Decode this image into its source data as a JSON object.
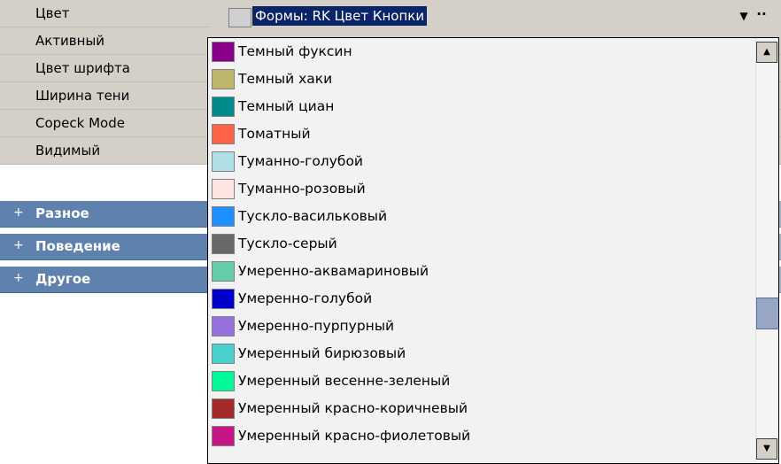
{
  "properties": [
    {
      "name": "Цвет"
    },
    {
      "name": "Активный"
    },
    {
      "name": "Цвет шрифта"
    },
    {
      "name": "Ширина тени"
    },
    {
      "name": "Copeck Mode"
    },
    {
      "name": "Видимый"
    }
  ],
  "groups": [
    {
      "label": "Разное",
      "expander": "+"
    },
    {
      "label": "Поведение",
      "expander": "+"
    },
    {
      "label": "Другое",
      "expander": "+"
    }
  ],
  "editor": {
    "value": "Формы: RK Цвет Кнопки",
    "swatch_color": "#d0d0d0",
    "dropdown_icon": "▼",
    "ellipsis_icon": "··"
  },
  "color_list": {
    "items": [
      {
        "label": "Темный фуксин",
        "color": "#8b008b"
      },
      {
        "label": "Темный хаки",
        "color": "#bdb76b"
      },
      {
        "label": "Темный циан",
        "color": "#008b8b"
      },
      {
        "label": "Томатный",
        "color": "#ff6347"
      },
      {
        "label": "Туманно-голубой",
        "color": "#b0e0e6"
      },
      {
        "label": "Туманно-розовый",
        "color": "#ffe4e1"
      },
      {
        "label": "Тускло-васильковый",
        "color": "#1e90ff"
      },
      {
        "label": "Тускло-серый",
        "color": "#696969"
      },
      {
        "label": "Умеренно-аквамариновый",
        "color": "#66cdaa"
      },
      {
        "label": "Умеренно-голубой",
        "color": "#0000cd"
      },
      {
        "label": "Умеренно-пурпурный",
        "color": "#9370db"
      },
      {
        "label": "Умеренный бирюзовый",
        "color": "#48d1cc"
      },
      {
        "label": "Умеренный весенне-зеленый",
        "color": "#00fa9a"
      },
      {
        "label": "Умеренный красно-коричневый",
        "color": "#a52a2a"
      },
      {
        "label": "Умеренный красно-фиолетовый",
        "color": "#c71585"
      }
    ],
    "scroll_up_icon": "▲",
    "scroll_down_icon": "▼"
  }
}
